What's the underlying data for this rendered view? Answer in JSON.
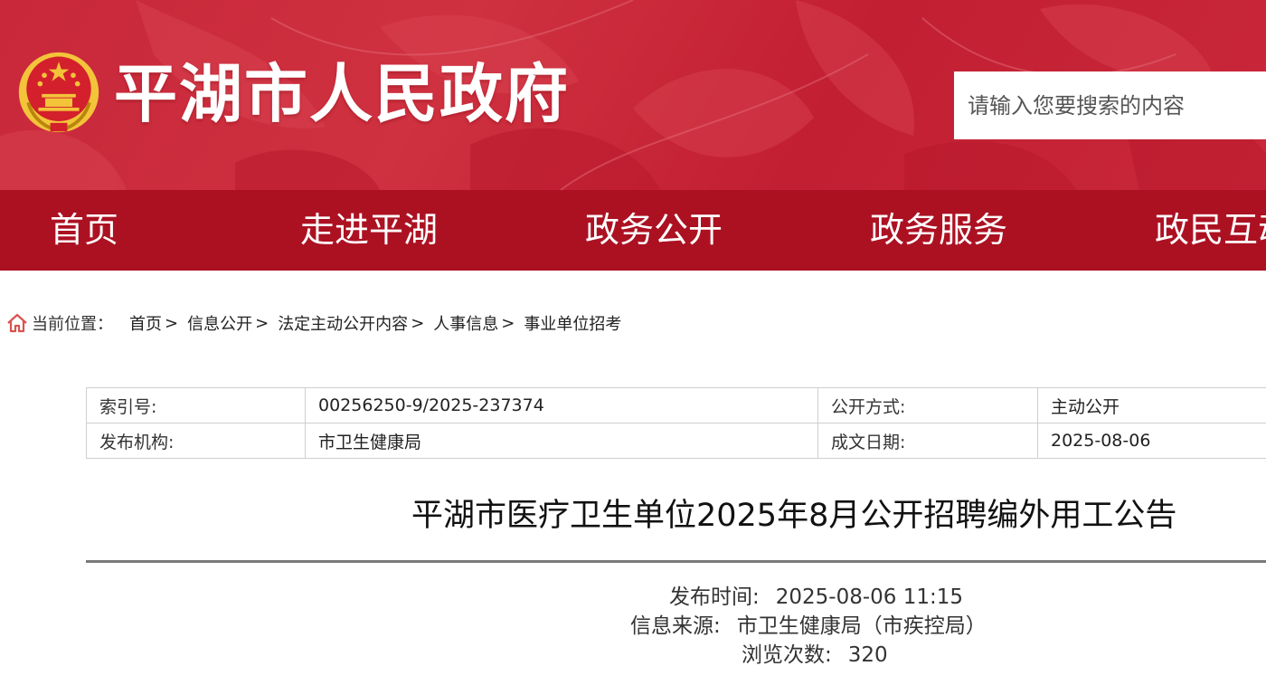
{
  "header": {
    "site_title": "平湖市人民政府",
    "search_placeholder": "请输入您要搜索的内容",
    "colors": {
      "banner": "#c8283a",
      "nav": "#ac1122",
      "emblem_gold": "#f3c43a"
    }
  },
  "nav": {
    "items": [
      {
        "label": "首页"
      },
      {
        "label": "走进平湖"
      },
      {
        "label": "政务公开"
      },
      {
        "label": "政务服务"
      },
      {
        "label": "政民互动"
      }
    ]
  },
  "breadcrumb": {
    "label": "当前位置：",
    "items": [
      "首页",
      "信息公开",
      "法定主动公开内容",
      "人事信息",
      "事业单位招考"
    ],
    "separator": ">"
  },
  "meta": {
    "rows": [
      {
        "k1": "索引号:",
        "v1": "00256250-9/2025-237374",
        "k2": "公开方式:",
        "v2": "主动公开"
      },
      {
        "k1": "发布机构:",
        "v1": "市卫生健康局",
        "k2": "成文日期:",
        "v2": "2025-08-06"
      }
    ]
  },
  "article": {
    "title": "平湖市医疗卫生单位2025年8月公开招聘编外用工公告",
    "publish_time_label": "发布时间:",
    "publish_time": "2025-08-06 11:15",
    "source_label": "信息来源:",
    "source": "市卫生健康局（市疾控局）",
    "views_label": "浏览次数:",
    "views": "320"
  }
}
